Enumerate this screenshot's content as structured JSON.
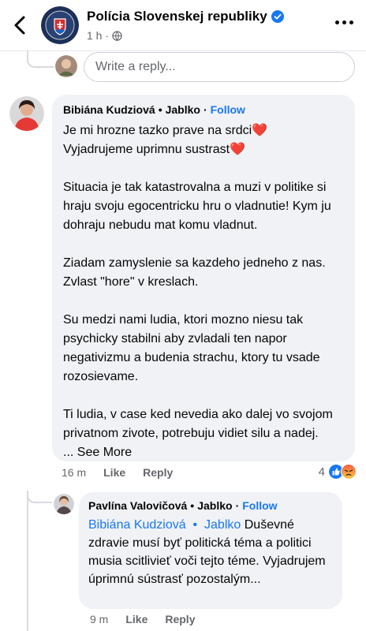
{
  "header": {
    "page_name": "Polícia Slovenskej republiky",
    "time": "1 h",
    "colors": {
      "verified": "#1877f2"
    }
  },
  "reply_box": {
    "placeholder": "Write a reply..."
  },
  "comment1": {
    "author": "Bibiána Kudziová",
    "badge": "Jablko",
    "follow": "Follow",
    "line1": "Je mi hrozne tazko prave na srdci",
    "line2": "Vyjadrujeme uprimnu sustrast",
    "para2": "Situacia je tak katastrovalna a muzi v politike si hraju svoju egocentricku hru o vladnutie! Kym ju dohraju nebudu mat komu vladnut.",
    "para3": "Ziadam zamyslenie sa kazdeho jedneho z nas. Zvlast \"hore\" v kreslach.",
    "para4": "Su medzi nami ludia, ktori mozno niesu tak psychicky stabilni aby zvladali ten napor negativizmu a budenia strachu, ktory tu vsade rozosievame.",
    "para5": "Ti ludia, v case ked nevedia ako dalej vo svojom privatnom zivote, potrebuju vidiet silu a nadej.",
    "see_more": "... See More",
    "time": "16 m",
    "like": "Like",
    "reply": "Reply",
    "reaction_count": "4"
  },
  "comment2": {
    "author": "Pavlína Valovičová",
    "badge": "Jablko",
    "follow": "Follow",
    "mention_name": "Bibiána Kudziová",
    "mention_badge": "Jablko",
    "text": "Duševné zdravie musí byť politická téma a politici musia scitlivieť voči tejto téme. Vyjadrujem úprimnú sústrasť pozostalým...",
    "time": "9 m",
    "like": "Like",
    "reply": "Reply"
  }
}
